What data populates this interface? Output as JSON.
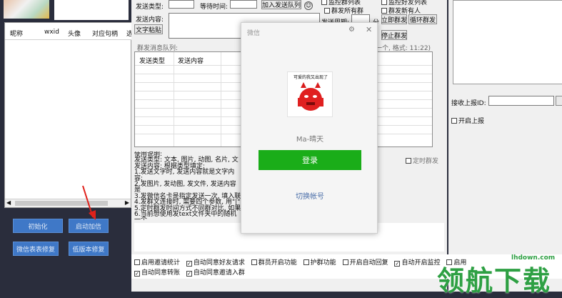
{
  "left": {
    "columns": [
      "昵称",
      "wxid",
      "头像",
      "对应句柄",
      "选"
    ],
    "buttons": {
      "init": "初始化",
      "auto_login": "启动加信",
      "wx_repair": "微信表表修复",
      "low_version_repair": "低版本修复"
    }
  },
  "top": {
    "send_type_label": "发送类型:",
    "wait_time_label": "等待时间:",
    "add_queue_button": "加入发送队列",
    "monitor_group": "监控群列表",
    "group_send_all": "群发所有群",
    "monitor_friend": "监控好友列表",
    "group_send_new": "群发新有人",
    "send_content_label": "发送内容:",
    "text_paste_button": "文字粘贴",
    "send_period_label": "发送周期:",
    "minutes_unit": "分",
    "start_group_send": "立即群发",
    "loop_group_send": "循环群发",
    "stop_group_send": "停止群发",
    "queue_label": "群发消息队列:",
    "format_hint": "一个, 格式: 11:22)"
  },
  "queue_table": {
    "headers": [
      "发送类型",
      "发送内容"
    ]
  },
  "timed_send": "定时群发",
  "instructions": {
    "lines": [
      "使用说明:",
      "发送类型: 文本, 图片, 动图, 名片, 文",
      "发送内容: 根据类型填定:",
      "1.发送文字时, 发送内容就是文字内容;",
      "2.发图片, 发动图, 发文件, 发送内容是",
      "3.发微信名卡是指定发送一次, 填入联",
      "4.发群文连接时, 需要四个参数, 用\"|\"",
      "5.定时群发时间方式不同群对比, 如果",
      "6.当前想使用发text文件夹中的随机一个"
    ]
  },
  "right": {
    "report_id_label": "接收上报ID:",
    "enable_report": "开启上报"
  },
  "bottom": {
    "row1": [
      "启用邀请统计",
      "自动同意好友请求",
      "群员开启功能",
      "护群功能",
      "开启自动回复",
      "自动开启监控",
      "启用"
    ],
    "row1_checked": [
      false,
      true,
      false,
      false,
      false,
      true,
      false
    ],
    "row2": [
      "自动同意转账",
      "自动同意邀请入群"
    ],
    "row2_checked": [
      true,
      true
    ]
  },
  "dialog": {
    "title": "微信",
    "avatar_caption": "可爱的我又出现了",
    "username": "Ma-晴天",
    "login_button": "登录",
    "switch_account": "切换帐号"
  },
  "watermark": {
    "site": "lhdown.com",
    "brand": "领航下载"
  },
  "colors": {
    "dialog_bg": "#f5f5f5",
    "login_green": "#1aad19",
    "switch_link": "#4a6ea9",
    "blue_button": "#3f78c7",
    "watermark_green": "#2ea043"
  }
}
